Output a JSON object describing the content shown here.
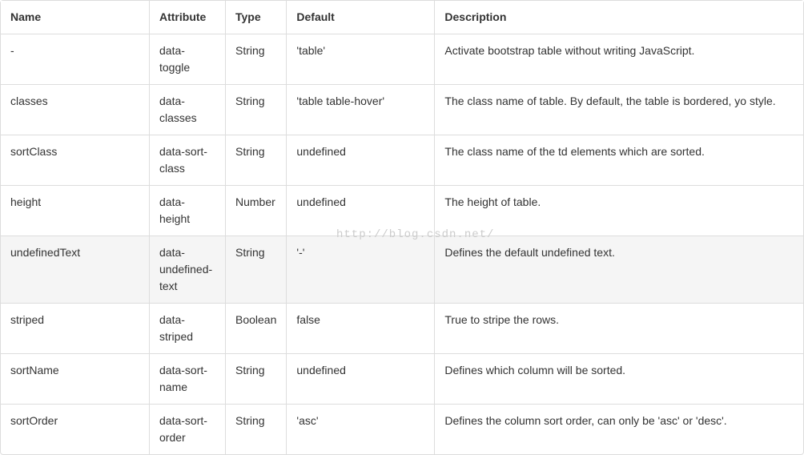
{
  "headers": {
    "name": "Name",
    "attribute": "Attribute",
    "type": "Type",
    "default": "Default",
    "description": "Description"
  },
  "rows": [
    {
      "name": "-",
      "attribute": "data-toggle",
      "type": "String",
      "default": "'table'",
      "description": "Activate bootstrap table without writing JavaScript.",
      "highlight": false
    },
    {
      "name": "classes",
      "attribute": "data-classes",
      "type": "String",
      "default": "'table table-hover'",
      "description": "The class name of table. By default, the table is bordered, yo style.",
      "highlight": false
    },
    {
      "name": "sortClass",
      "attribute": "data-sort-class",
      "type": "String",
      "default": "undefined",
      "description": "The class name of the td elements which are sorted.",
      "highlight": false
    },
    {
      "name": "height",
      "attribute": "data-height",
      "type": "Number",
      "default": "undefined",
      "description": "The height of table.",
      "highlight": false
    },
    {
      "name": "undefinedText",
      "attribute": "data-undefined-text",
      "type": "String",
      "default": "'-'",
      "description": "Defines the default undefined text.",
      "highlight": true
    },
    {
      "name": "striped",
      "attribute": "data-striped",
      "type": "Boolean",
      "default": "false",
      "description": "True to stripe the rows.",
      "highlight": false
    },
    {
      "name": "sortName",
      "attribute": "data-sort-name",
      "type": "String",
      "default": "undefined",
      "description": "Defines which column will be sorted.",
      "highlight": false
    },
    {
      "name": "sortOrder",
      "attribute": "data-sort-order",
      "type": "String",
      "default": "'asc'",
      "description": "Defines the column sort order, can only be 'asc' or 'desc'.",
      "highlight": false
    }
  ],
  "watermark": "http://blog.csdn.net/"
}
